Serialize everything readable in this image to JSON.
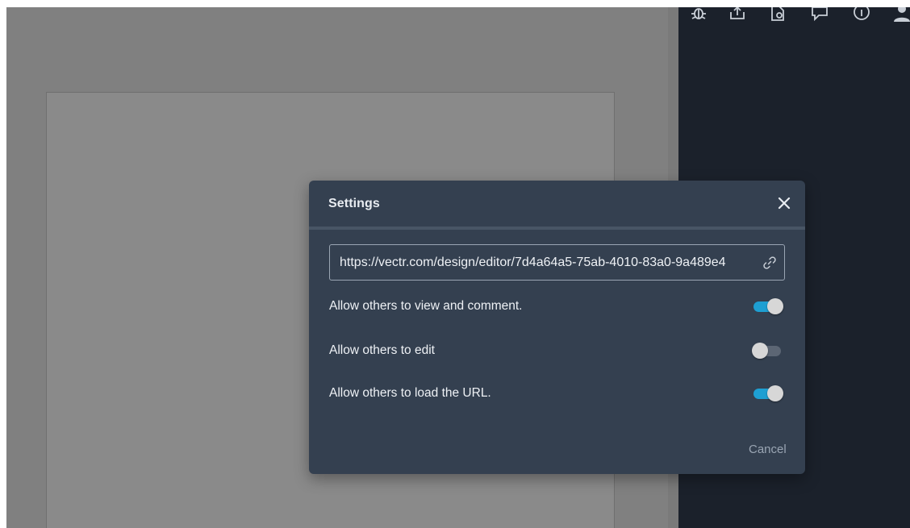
{
  "dialog": {
    "title": "Settings",
    "url_value": "https://vectr.com/design/editor/7d4a64a5-75ab-4010-83a0-9a489e4",
    "options": [
      {
        "label": "Allow others to view and comment.",
        "enabled": true
      },
      {
        "label": "Allow others to edit",
        "enabled": false
      },
      {
        "label": "Allow others to load the URL.",
        "enabled": true
      }
    ],
    "cancel_label": "Cancel"
  },
  "toolbar": {
    "icons": [
      "bug-icon",
      "upload-icon",
      "add-page-icon",
      "chat-icon",
      "info-icon",
      "user-icon"
    ]
  },
  "colors": {
    "dialog_bg": "#344050",
    "toggle_on": "#1e9fd2",
    "side_panel": "#1b212b",
    "workspace_dim": "#808080"
  }
}
